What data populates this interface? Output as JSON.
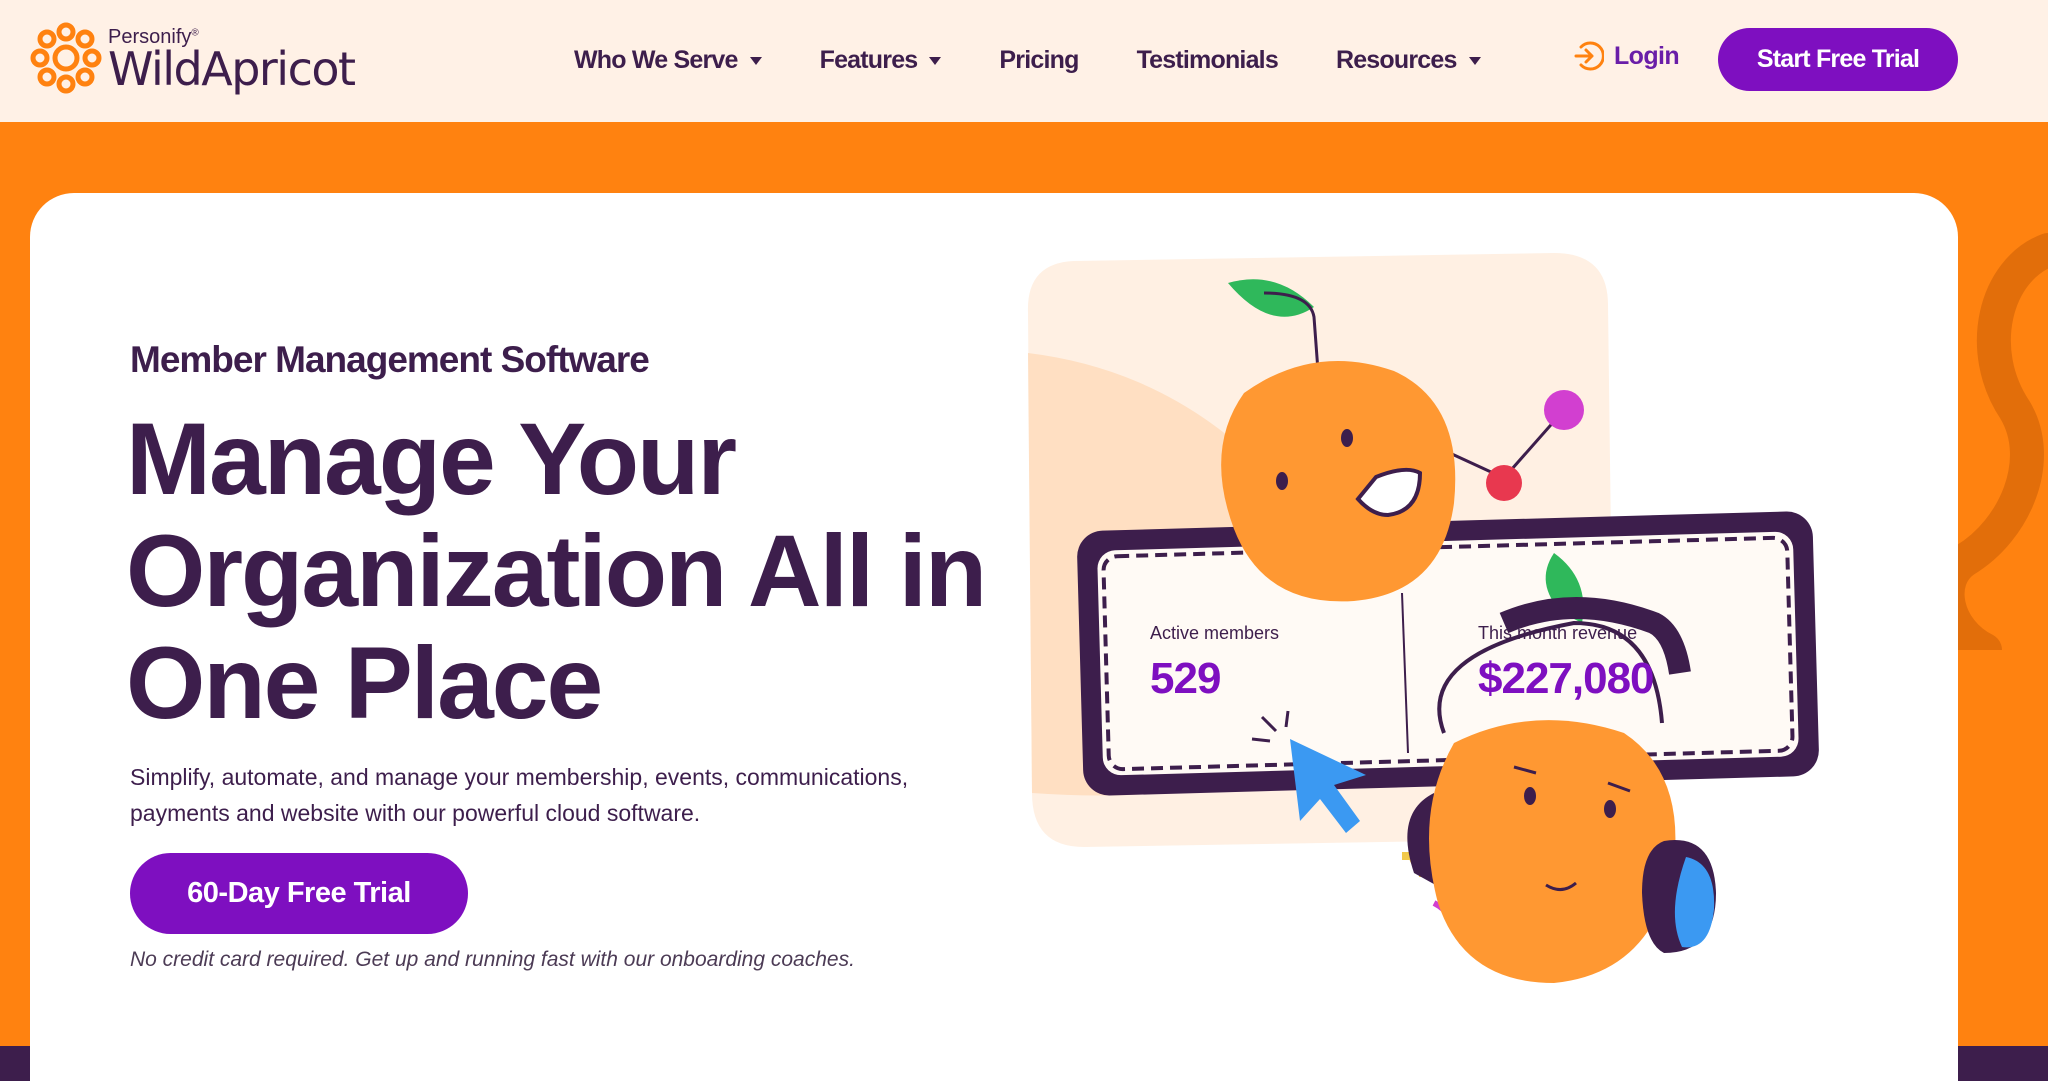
{
  "brand": {
    "parent": "Personify",
    "name": "WildApricot",
    "colors": {
      "orange": "#ff8210",
      "purple": "#7e0fc0",
      "dark": "#3d1e4c",
      "cream": "#fff1e6"
    }
  },
  "nav": {
    "items": [
      {
        "label": "Who We Serve",
        "dropdown": true
      },
      {
        "label": "Features",
        "dropdown": true
      },
      {
        "label": "Pricing",
        "dropdown": false
      },
      {
        "label": "Testimonials",
        "dropdown": false
      },
      {
        "label": "Resources",
        "dropdown": true
      }
    ],
    "login": {
      "label": "Login",
      "icon": "login-arrow-icon"
    },
    "cta": "Start Free Trial"
  },
  "hero": {
    "eyebrow": "Member Management Software",
    "headline": "Manage Your Organization All in One Place",
    "subtext": "Simplify, automate, and manage your membership, events, communications, payments and website with our powerful cloud software.",
    "cta": "60-Day Free Trial",
    "note": "No credit card required. Get up and running fast with our onboarding coaches."
  },
  "illustration": {
    "stats": [
      {
        "label": "Active members",
        "value": "529"
      },
      {
        "label": "This month revenue",
        "value": "$227,080"
      }
    ],
    "icons": [
      "apricot-mascot",
      "apricot-headphones-mascot",
      "cursor-icon",
      "gear-icon"
    ]
  }
}
